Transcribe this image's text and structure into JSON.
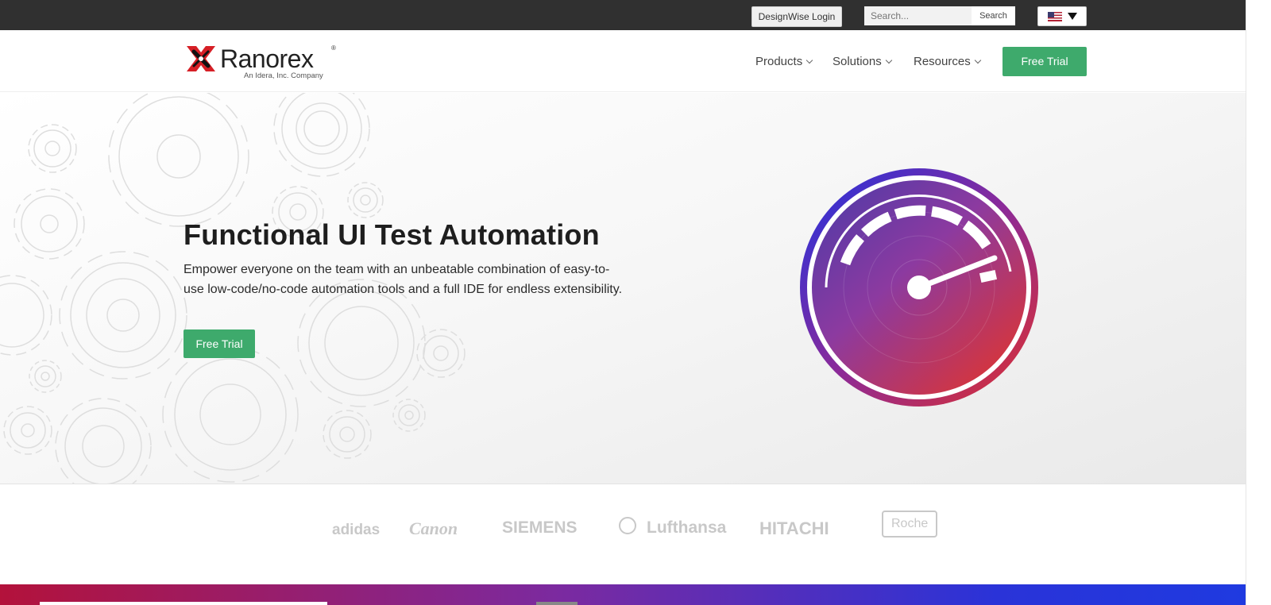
{
  "topbar": {
    "login_label": "DesignWise Login",
    "search_placeholder": "Search...",
    "search_button": "Search",
    "language_icon": "us-flag-icon"
  },
  "nav": {
    "logo_text": "Ranorex",
    "logo_registered": "®",
    "logo_subtitle": "An Idera, Inc. Company",
    "items": [
      {
        "label": "Products"
      },
      {
        "label": "Solutions"
      },
      {
        "label": "Resources"
      }
    ],
    "cta_label": "Free Trial"
  },
  "hero": {
    "title": "Functional UI Test Automation",
    "description": "Empower everyone on the team with an unbeatable combination of easy-to-use low-code/no-code automation tools and a full IDE for endless extensibility.",
    "cta_label": "Free Trial"
  },
  "logos": {
    "brands": [
      "adidas",
      "Canon",
      "SIEMENS",
      "Lufthansa",
      "HITACHI",
      "Roche"
    ]
  },
  "colors": {
    "accent_green": "#3eaa6c",
    "topbar_bg": "#303030",
    "gauge_blue": "#2233e0",
    "gauge_red": "#e0302b"
  }
}
